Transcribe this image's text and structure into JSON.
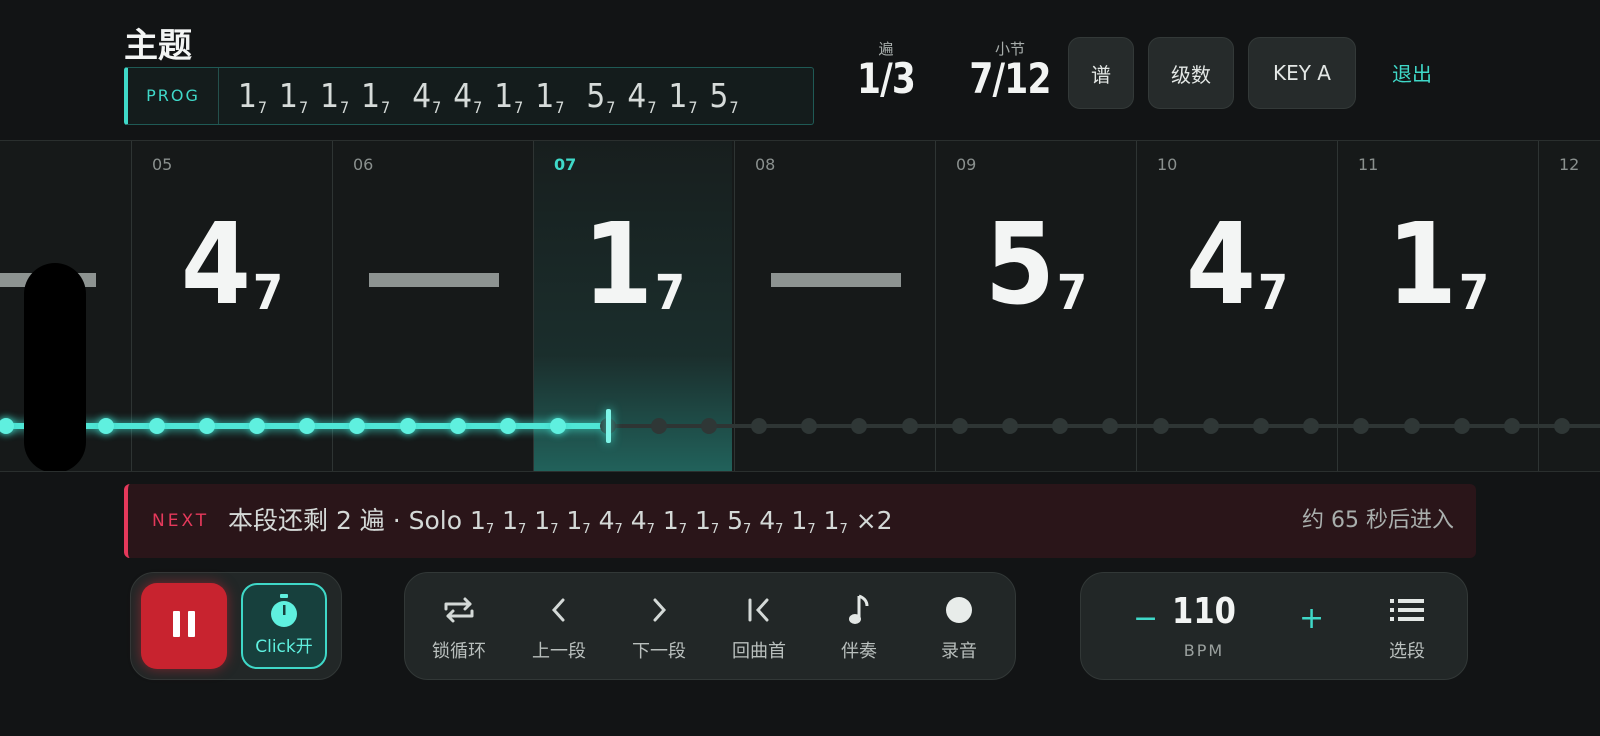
{
  "header": {
    "title": "主题",
    "prog_label": "PROG",
    "progression": [
      [
        "1",
        "7"
      ],
      [
        "1",
        "7"
      ],
      [
        "1",
        "7"
      ],
      [
        "1",
        "7"
      ],
      [
        "4",
        "7"
      ],
      [
        "4",
        "7"
      ],
      [
        "1",
        "7"
      ],
      [
        "1",
        "7"
      ],
      [
        "5",
        "7"
      ],
      [
        "4",
        "7"
      ],
      [
        "1",
        "7"
      ],
      [
        "5",
        "7"
      ]
    ],
    "pass_caption": "遍",
    "pass_value": "1/3",
    "bar_caption": "小节",
    "bar_value": "7/12",
    "buttons": {
      "score": "谱",
      "degrees": "级数",
      "key": "KEY A"
    },
    "exit": "退出"
  },
  "measures": [
    {
      "num": "05",
      "root": "4",
      "ext": "7",
      "dash": false,
      "active": false
    },
    {
      "num": "06",
      "root": "",
      "ext": "",
      "dash": true,
      "active": false
    },
    {
      "num": "07",
      "root": "1",
      "ext": "7",
      "dash": false,
      "active": true
    },
    {
      "num": "08",
      "root": "",
      "ext": "",
      "dash": true,
      "active": false
    },
    {
      "num": "09",
      "root": "5",
      "ext": "7",
      "dash": false,
      "active": false
    },
    {
      "num": "10",
      "root": "4",
      "ext": "7",
      "dash": false,
      "active": false
    },
    {
      "num": "11",
      "root": "1",
      "ext": "7",
      "dash": false,
      "active": false
    },
    {
      "num": "12",
      "root": "",
      "ext": "",
      "dash": false,
      "active": false
    }
  ],
  "next": {
    "label": "NEXT",
    "text_prefix": "本段还剩 2 遍 · Solo",
    "chords": [
      [
        "1",
        "7"
      ],
      [
        "1",
        "7"
      ],
      [
        "1",
        "7"
      ],
      [
        "1",
        "7"
      ],
      [
        "4",
        "7"
      ],
      [
        "4",
        "7"
      ],
      [
        "1",
        "7"
      ],
      [
        "1",
        "7"
      ],
      [
        "5",
        "7"
      ],
      [
        "4",
        "7"
      ],
      [
        "1",
        "7"
      ],
      [
        "1",
        "7"
      ]
    ],
    "suffix": "×2",
    "eta": "约 65 秒后进入"
  },
  "transport": {
    "click_label": "Click开",
    "controls": [
      {
        "name": "loop",
        "label": "锁循环"
      },
      {
        "name": "prev",
        "label": "上一段"
      },
      {
        "name": "next",
        "label": "下一段"
      },
      {
        "name": "restart",
        "label": "回曲首"
      },
      {
        "name": "accompany",
        "label": "伴奏"
      },
      {
        "name": "record",
        "label": "录音"
      }
    ]
  },
  "tempo": {
    "minus": "−",
    "value": "110",
    "unit": "BPM",
    "plus": "+",
    "sections_label": "选段"
  },
  "colors": {
    "accent": "#3fd8c8",
    "danger": "#e5395b",
    "pause": "#c8232f"
  }
}
